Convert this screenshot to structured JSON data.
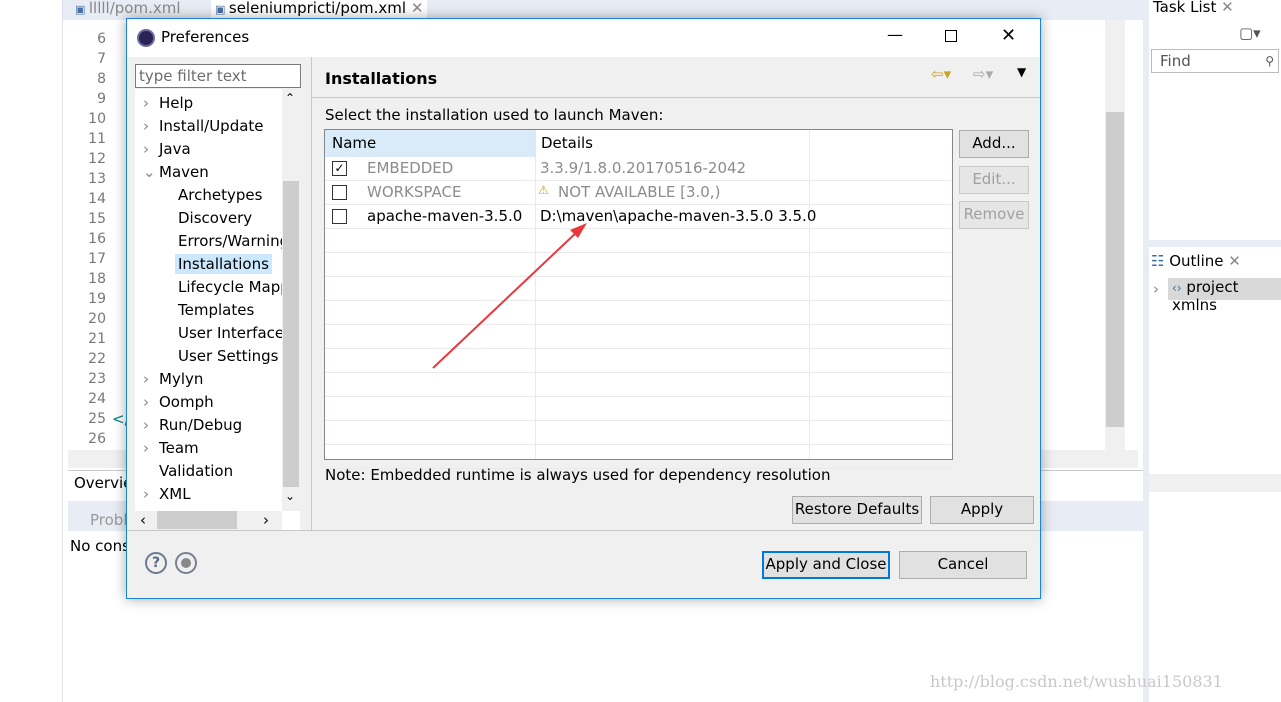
{
  "ide": {
    "tabs": [
      {
        "label": "lllll/pom.xml"
      },
      {
        "label": "seleniumpricti/pom.xml"
      }
    ],
    "line_numbers": [
      "6",
      "7",
      "8",
      "9",
      "10",
      "11",
      "12",
      "13",
      "14",
      "15",
      "16",
      "17",
      "18",
      "19",
      "20",
      "21",
      "22",
      "23",
      "24",
      "25",
      "26"
    ],
    "code_line_25": "</",
    "overview_tab": "Overview",
    "problems_tab": "Problems",
    "console_text": "No consoles",
    "task_list": {
      "title": "Task List",
      "find_placeholder": "Find"
    },
    "outline": {
      "title": "Outline",
      "item": "project xmlns"
    }
  },
  "dialog": {
    "title": "Preferences",
    "filter_placeholder": "type filter text",
    "tree": [
      {
        "label": "Help",
        "expandable": true,
        "level": 0
      },
      {
        "label": "Install/Update",
        "expandable": true,
        "level": 0
      },
      {
        "label": "Java",
        "expandable": true,
        "level": 0
      },
      {
        "label": "Maven",
        "expandable": true,
        "expanded": true,
        "level": 0
      },
      {
        "label": "Archetypes",
        "level": 1
      },
      {
        "label": "Discovery",
        "level": 1
      },
      {
        "label": "Errors/Warnings",
        "level": 1
      },
      {
        "label": "Installations",
        "level": 1,
        "selected": true
      },
      {
        "label": "Lifecycle Mappings",
        "level": 1
      },
      {
        "label": "Templates",
        "level": 1
      },
      {
        "label": "User Interface",
        "level": 1
      },
      {
        "label": "User Settings",
        "level": 1
      },
      {
        "label": "Mylyn",
        "expandable": true,
        "level": 0
      },
      {
        "label": "Oomph",
        "expandable": true,
        "level": 0
      },
      {
        "label": "Run/Debug",
        "expandable": true,
        "level": 0
      },
      {
        "label": "Team",
        "expandable": true,
        "level": 0
      },
      {
        "label": "Validation",
        "level": 0
      },
      {
        "label": "XML",
        "expandable": true,
        "level": 0
      }
    ],
    "page_title": "Installations",
    "instruction": "Select the installation used to launch Maven:",
    "table": {
      "columns": [
        "Name",
        "Details"
      ],
      "rows": [
        {
          "checked": true,
          "name": "EMBEDDED",
          "details": "3.3.9/1.8.0.20170516-2042",
          "disabled": true
        },
        {
          "checked": false,
          "name": "WORKSPACE",
          "details": "NOT AVAILABLE [3.0,)",
          "warning": true,
          "disabled": true
        },
        {
          "checked": false,
          "name": "apache-maven-3.5.0",
          "details": "D:\\maven\\apache-maven-3.5.0 3.5.0"
        }
      ]
    },
    "buttons": {
      "add": "Add...",
      "edit": "Edit...",
      "remove": "Remove",
      "restore": "Restore Defaults",
      "apply": "Apply",
      "apply_close": "Apply and Close",
      "cancel": "Cancel"
    },
    "note": "Note: Embedded runtime is always used for dependency resolution"
  },
  "watermark": "http://blog.csdn.net/wushuai150831",
  "colors": {
    "accent": "#1883d7",
    "selection": "#cce8ff",
    "arrow": "#e8383d"
  }
}
